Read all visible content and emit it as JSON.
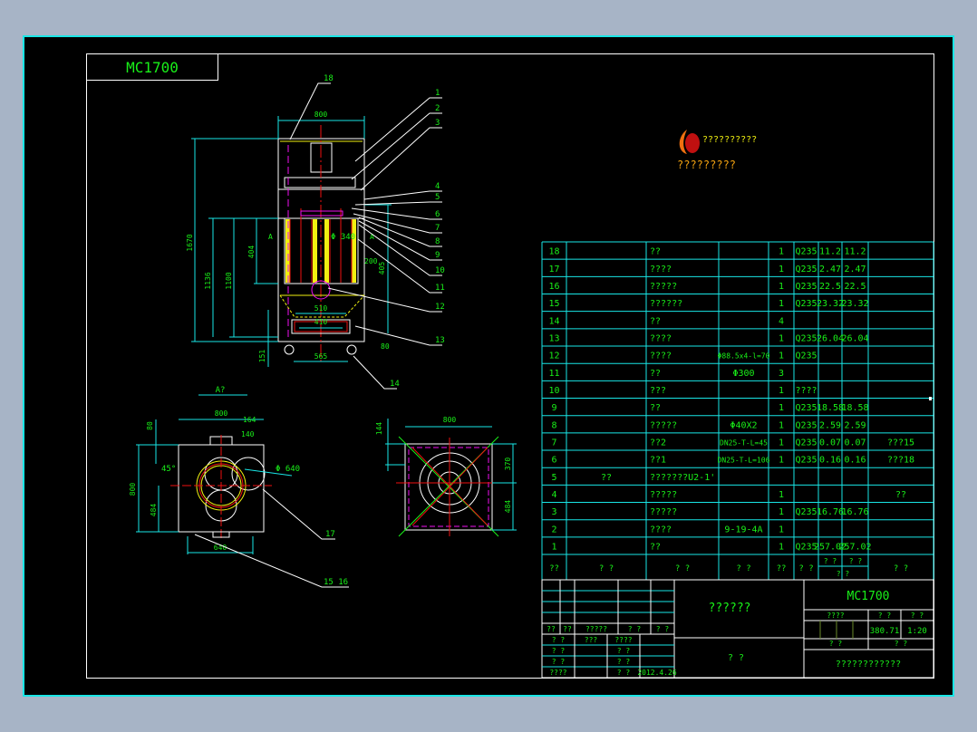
{
  "drawing": {
    "tag_label": "MC1700",
    "colors": {
      "background": "#000000",
      "frame": "#19e6e6",
      "text": "#19f019",
      "outline": "#ffffff",
      "centerline": "#f01010",
      "filter": "#f0f010",
      "hidden": "#f010f0"
    },
    "main_view": {
      "dims": {
        "width": "800",
        "total_height": "1670",
        "h1": "1136",
        "h2": "1100",
        "h3": "404",
        "bottom_w1": "510",
        "bottom_w2": "410",
        "base_w": "565",
        "foot": "151",
        "side": "80",
        "dia": "Φ 340",
        "d200": "200",
        "d405": "405"
      },
      "section_marks": [
        "A",
        "A"
      ],
      "part_labels": [
        "18",
        "1",
        "2",
        "3",
        "4",
        "5",
        "6",
        "7",
        "8",
        "9",
        "10",
        "11",
        "12",
        "13",
        "14"
      ]
    },
    "section_view": {
      "title": "A?",
      "dims": {
        "width": "800",
        "d164": "164",
        "d140": "140",
        "d80": "80",
        "height": "800",
        "h484": "484",
        "angle": "45°",
        "dia": "Φ 640",
        "bottom": "640"
      },
      "part_labels": [
        "17",
        "15 16"
      ]
    },
    "side_view": {
      "dims": {
        "width": "800",
        "d144": "144",
        "d370": "370",
        "d484": "484"
      }
    },
    "logo": {
      "line1": "??????????",
      "line2": "?????????"
    }
  },
  "bom": {
    "rows": [
      [
        "18",
        "",
        "??",
        "",
        "1",
        "Q235",
        "11.2",
        "11.2",
        ""
      ],
      [
        "17",
        "",
        "????",
        "",
        "1",
        "Q235",
        "2.47",
        "2.47",
        ""
      ],
      [
        "16",
        "",
        "?????",
        "",
        "1",
        "Q235",
        "22.5",
        "22.5",
        ""
      ],
      [
        "15",
        "",
        "??????",
        "",
        "1",
        "Q235",
        "23.32",
        "23.32",
        ""
      ],
      [
        "14",
        "",
        "??",
        "",
        "4",
        "",
        "",
        "",
        ""
      ],
      [
        "13",
        "",
        "????",
        "",
        "1",
        "Q235",
        "26.04",
        "26.04",
        ""
      ],
      [
        "12",
        "",
        "????",
        "Φ88.5x4-l=70",
        "1",
        "Q235",
        "",
        "",
        ""
      ],
      [
        "11",
        "",
        "??",
        "Φ300",
        "3",
        "",
        "",
        "",
        ""
      ],
      [
        "10",
        "",
        "???",
        "",
        "1",
        "????",
        "",
        "",
        ""
      ],
      [
        "9",
        "",
        "??",
        "",
        "1",
        "Q235",
        "18.58",
        "18.58",
        ""
      ],
      [
        "8",
        "",
        "?????",
        "Φ40X2",
        "1",
        "Q235",
        "2.59",
        "2.59",
        ""
      ],
      [
        "7",
        "",
        "??2",
        "DN25-T-L=45",
        "1",
        "Q235",
        "0.07",
        "0.07",
        "???15"
      ],
      [
        "6",
        "",
        "??1",
        "DN25-T-L=106",
        "1",
        "Q235",
        "0.16",
        "0.16",
        "???18"
      ],
      [
        "5",
        "??",
        "???????U2-1'",
        "",
        "",
        "",
        "",
        "",
        ""
      ],
      [
        "4",
        "",
        "?????",
        "",
        "1",
        "",
        "",
        "",
        "??"
      ],
      [
        "3",
        "",
        "?????",
        "",
        "1",
        "Q235",
        "16.76",
        "16.76",
        ""
      ],
      [
        "2",
        "",
        "????",
        "9-19-4A",
        "1",
        "",
        "",
        "",
        ""
      ],
      [
        "1",
        "",
        "??",
        "",
        "1",
        "Q235",
        "257.02",
        "257.02",
        ""
      ]
    ],
    "header": [
      "??",
      "? ?",
      "? ?",
      "? ?",
      "??",
      "? ?",
      "? ?",
      "? ?",
      "? ?",
      "? ?"
    ]
  },
  "title_block": {
    "left_labels": [
      "??",
      "??",
      "?????",
      "? ?",
      "? ?"
    ],
    "sign_rows": [
      [
        "? ?",
        "???",
        "????",
        ""
      ],
      [
        "? ?",
        "",
        "? ?",
        ""
      ],
      [
        "? ?",
        "",
        "? ?",
        ""
      ],
      [
        "????",
        "",
        "? ?",
        "2012.4.26"
      ]
    ],
    "drawing_name": "??????",
    "company": "? ?",
    "drawing_no": "MC1700",
    "headers": [
      "????",
      "? ?",
      "? ?"
    ],
    "weight": "380.71",
    "scale": "1:20",
    "sheet": [
      "?   ?",
      "?   ?"
    ],
    "note": "????????????"
  }
}
